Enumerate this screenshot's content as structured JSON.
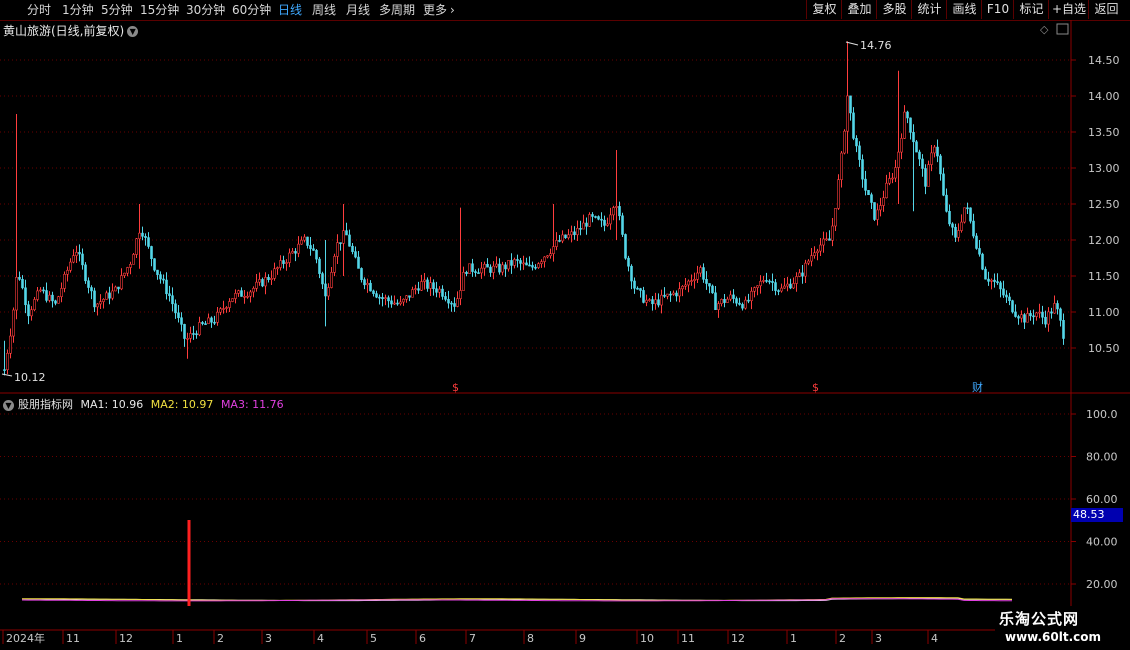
{
  "toolbar": {
    "periods": [
      "分时",
      "1分钟",
      "5分钟",
      "15分钟",
      "30分钟",
      "60分钟",
      "日线",
      "周线",
      "月线",
      "多周期",
      "更多"
    ],
    "active_period": "日线",
    "buttons": [
      "复权",
      "叠加",
      "多股",
      "统计",
      "画线",
      "F10",
      "标记",
      "+自选",
      "返回"
    ]
  },
  "main_chart": {
    "title": "黄山旅游(日线,前复权)",
    "high_label": "14.76",
    "low_label": "10.12",
    "y_ticks": [
      "14.50",
      "14.00",
      "13.50",
      "13.00",
      "12.50",
      "12.00",
      "11.50",
      "11.00",
      "10.50"
    ],
    "markers": [
      "$",
      "$",
      "财"
    ]
  },
  "indicator": {
    "name": "股朋指标网",
    "ma1_label": "MA1: 10.96",
    "ma2_label": "MA2: 10.97",
    "ma3_label": "MA3: 11.76",
    "current_value": "48.53",
    "y_ticks": [
      "100.0",
      "80.00",
      "60.00",
      "40.00",
      "20.00"
    ]
  },
  "time_axis": {
    "labels": [
      "2024年",
      "11",
      "12",
      "1",
      "2",
      "3",
      "4",
      "5",
      "6",
      "7",
      "8",
      "9",
      "10",
      "11",
      "12",
      "1",
      "2",
      "3",
      "4"
    ]
  },
  "watermark": {
    "line1": "乐淘公式网",
    "line2": "www.60lt.com"
  },
  "colors": {
    "up": "#ff3d3d",
    "down": "#54d6e8",
    "ma1": "#e8e8e8",
    "ma2": "#f0e040",
    "ma3": "#e040e0",
    "accent_blue": "#3fa9ff",
    "grid": "#6a0000"
  },
  "chart_data": {
    "type": "candlestick",
    "title": "黄山旅游(日线,前复权)",
    "ylim": [
      10.12,
      14.76
    ],
    "high": 14.76,
    "low": 10.12,
    "indicator": {
      "ylim": [
        0,
        100
      ],
      "ma1": 10.96,
      "ma2": 10.97,
      "ma3": 11.76,
      "last_value": 48.53
    }
  }
}
